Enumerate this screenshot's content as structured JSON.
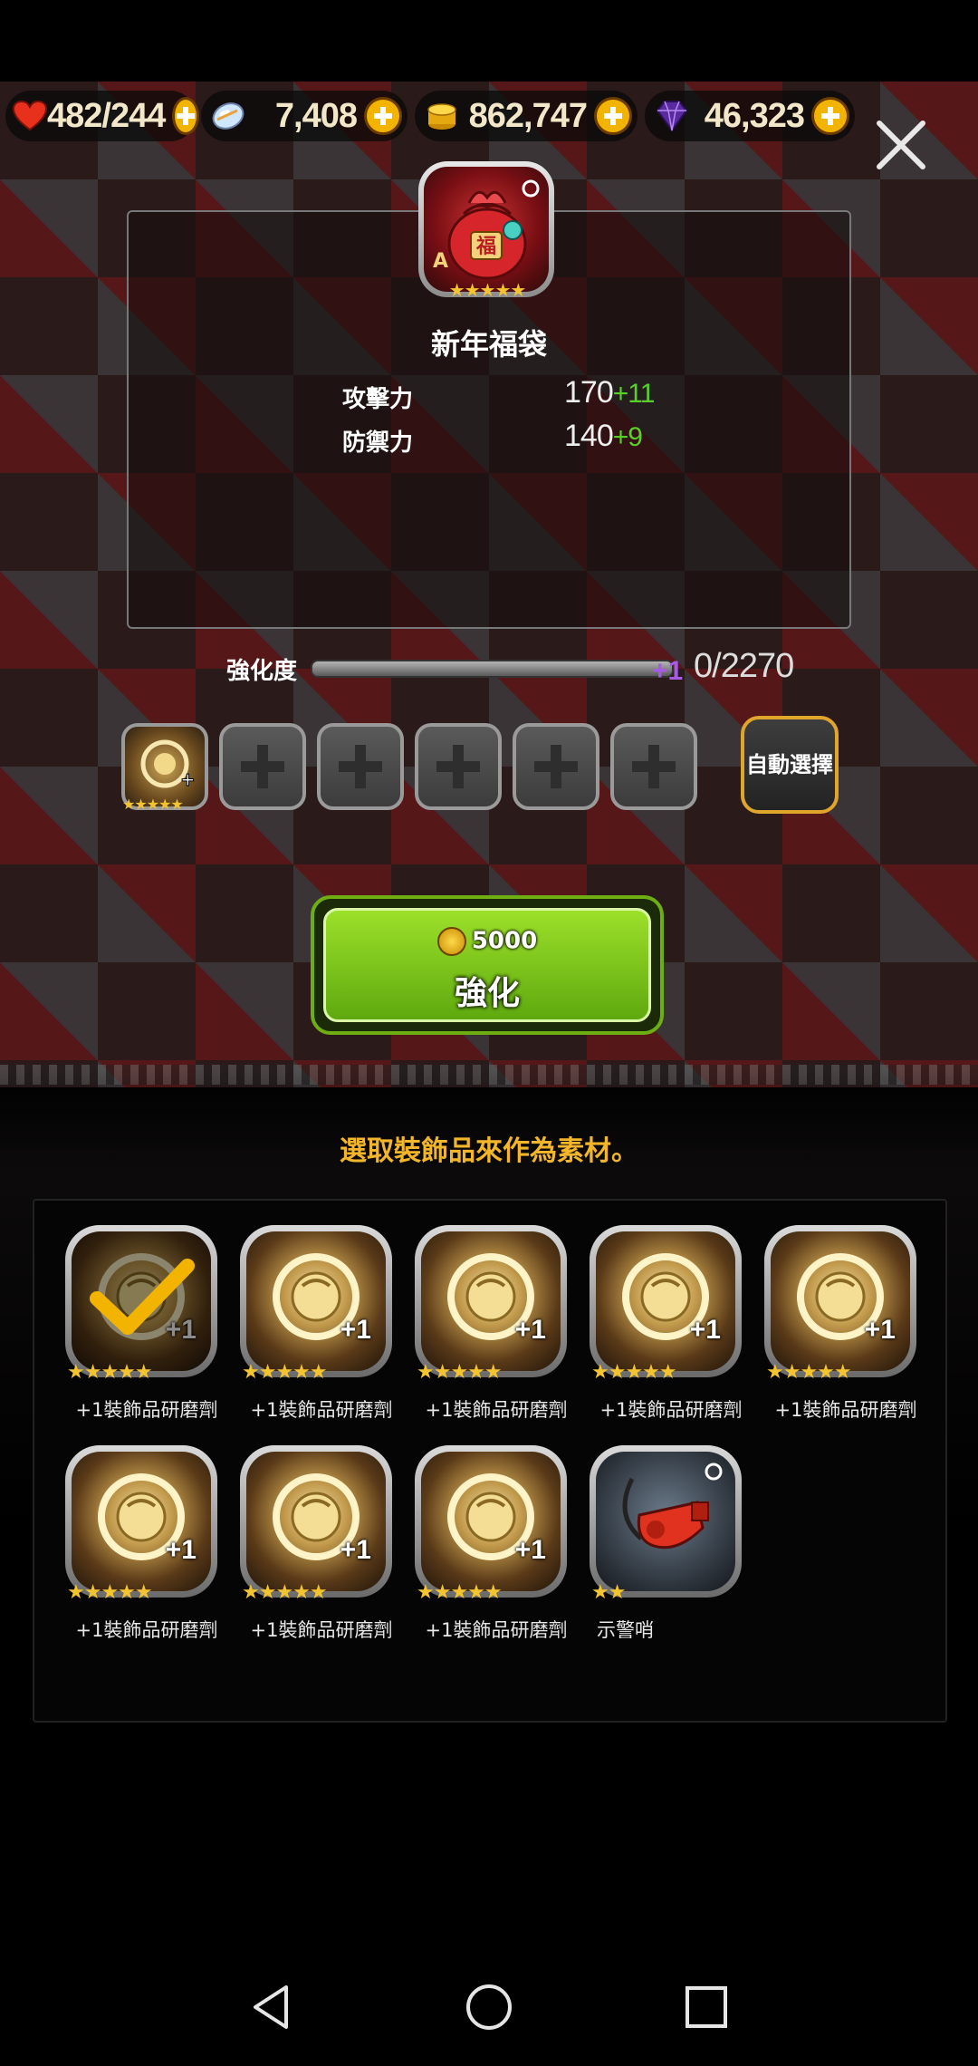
{
  "resources": {
    "stamina": {
      "value": "482/244",
      "icon": "heart-icon"
    },
    "crystal": {
      "value": "7,408",
      "icon": "crystal-icon"
    },
    "gold": {
      "value": "862,747",
      "icon": "coin-stack-icon"
    },
    "gem": {
      "value": "46,323",
      "icon": "purple-gem-icon"
    }
  },
  "equipment": {
    "grade": "A",
    "stars": "★★★★★",
    "name": "新年福袋",
    "stats": [
      {
        "label": "攻擊力",
        "value": "170",
        "bonus": "+11"
      },
      {
        "label": "防禦力",
        "value": "140",
        "bonus": "+9"
      }
    ]
  },
  "enhancement": {
    "label": "強化度",
    "gain": "+1",
    "progress": "0/2270",
    "progress_fraction": 0
  },
  "slots": {
    "filled_stars": "★★★★★",
    "filled_plus": "+1"
  },
  "auto_select_label": "自動選擇",
  "enhance_button": {
    "cost": "5000",
    "label": "強化"
  },
  "hint": "選取裝飾品來作為素材。",
  "materials": [
    {
      "label": "+1裝飾品研磨劑",
      "stars": "★★★★★",
      "plus": "+1",
      "selected": true
    },
    {
      "label": "+1裝飾品研磨劑",
      "stars": "★★★★★",
      "plus": "+1",
      "selected": false
    },
    {
      "label": "+1裝飾品研磨劑",
      "stars": "★★★★★",
      "plus": "+1",
      "selected": false
    },
    {
      "label": "+1裝飾品研磨劑",
      "stars": "★★★★★",
      "plus": "+1",
      "selected": false
    },
    {
      "label": "+1裝飾品研磨劑",
      "stars": "★★★★★",
      "plus": "+1",
      "selected": false
    },
    {
      "label": "+1裝飾品研磨劑",
      "stars": "★★★★★",
      "plus": "+1",
      "selected": false
    },
    {
      "label": "+1裝飾品研磨劑",
      "stars": "★★★★★",
      "plus": "+1",
      "selected": false
    },
    {
      "label": "+1裝飾品研磨劑",
      "stars": "★★★★★",
      "plus": "+1",
      "selected": false
    },
    {
      "label": "示警哨",
      "stars": "★★",
      "plus": "",
      "selected": false
    }
  ],
  "colors": {
    "accent_gold": "#f3b62a",
    "bonus_green": "#59d02a",
    "gain_purple": "#a65ae6",
    "button_green": "#7fcc1c"
  }
}
